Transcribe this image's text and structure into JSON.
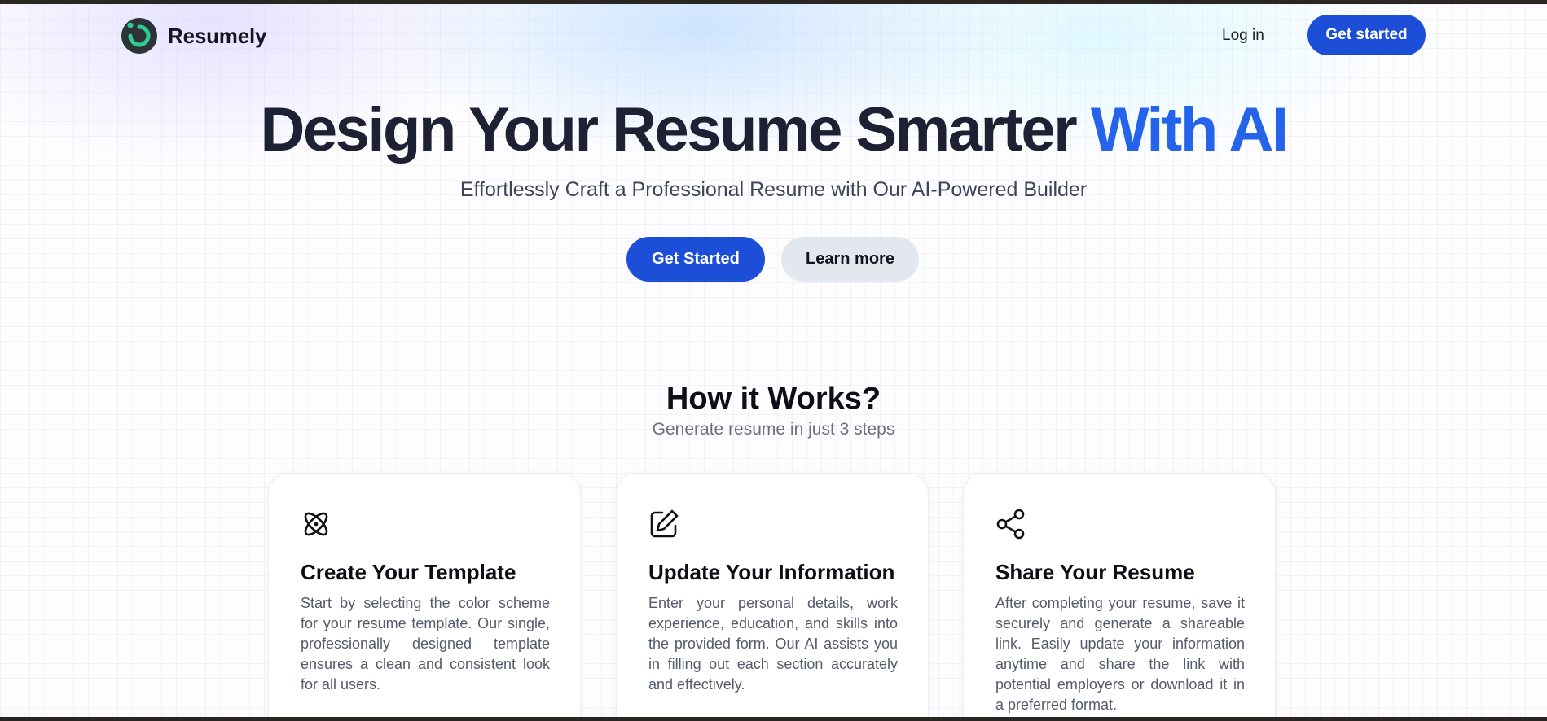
{
  "header": {
    "brand": "Resumely",
    "login_label": "Log in",
    "cta_label": "Get started",
    "logo_icon": "resumely-logo-icon"
  },
  "hero": {
    "title_main": "Design Your Resume Smarter",
    "title_accent": "With AI",
    "subtitle": "Effortlessly Craft a Professional Resume with Our AI-Powered Builder",
    "primary_label": "Get Started",
    "secondary_label": "Learn more"
  },
  "how": {
    "title": "How it Works?",
    "subtitle": "Generate resume in just 3 steps",
    "steps": [
      {
        "icon": "atom-icon",
        "title": "Create Your Template",
        "body": "Start by selecting the color scheme for your resume template. Our single, professionally designed template ensures a clean and consistent look for all users."
      },
      {
        "icon": "edit-icon",
        "title": "Update Your Information",
        "body": "Enter your personal details, work experience, education, and skills into the provided form. Our AI assists you in filling out each section accurately and effectively."
      },
      {
        "icon": "share-icon",
        "title": "Share Your Resume",
        "body": "After completing your resume, save it securely and generate a shareable link. Easily update your information anytime and share the link with potential employers or download it in a preferred format."
      }
    ]
  },
  "colors": {
    "primary": "#1d4ed8",
    "accent_text": "#2563eb",
    "logo_dark": "#2d3438",
    "logo_green": "#2ecc8f",
    "secondary_button": "#e3e7ee"
  }
}
